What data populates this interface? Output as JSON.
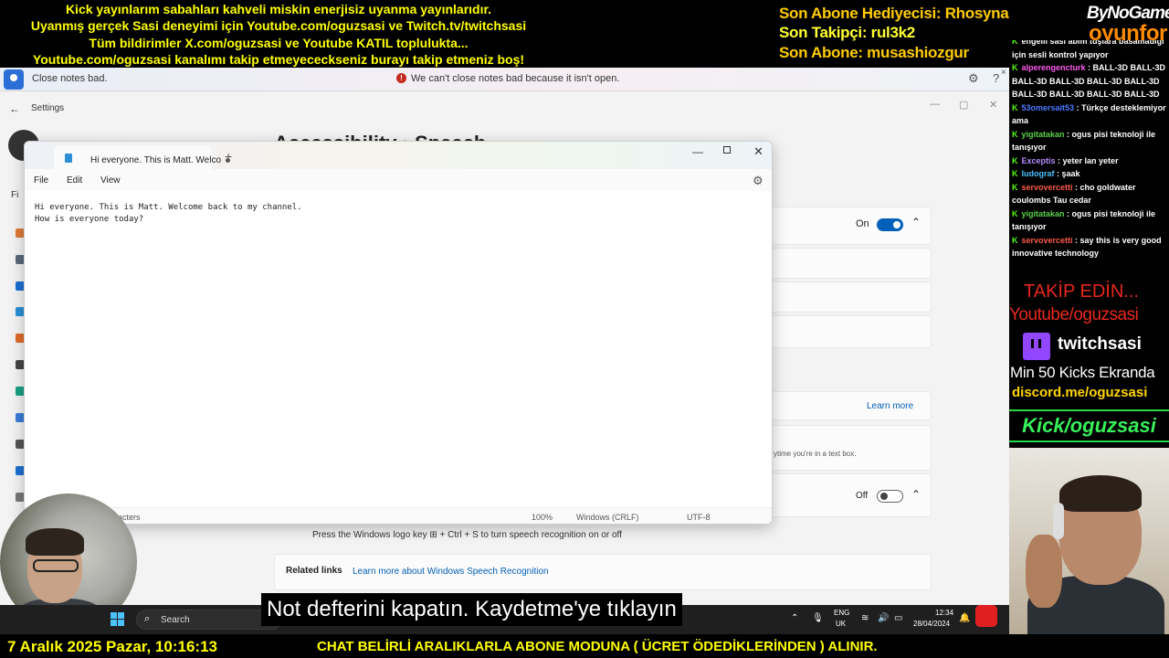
{
  "banner": {
    "lines": [
      "Kick yayınlarım sabahları kahveli miskin enerjisiz uyanma yayınlarıdır.",
      "Uyanmış gerçek Sasi deneyimi için Youtube.com/oguzsasi ve Twitch.tv/twitchsasi",
      "Tüm bildirimler X.com/oguzsasi ve Youtube KATIL toplulukta...",
      "Youtube.com/oguzsasi kanalımı takip etmeyececkseniz burayı takip etmeniz boş!"
    ],
    "sub_gift": "Son Abone Hediyecisi: Rhosyna",
    "last_follower": "Son Takipçi: rul3k2",
    "last_sub": "Son Abone: musashiozgur",
    "brand_top": "ByNoGame",
    "brand_bottom": "oyunfor"
  },
  "notification": {
    "left_text": "Close notes bad.",
    "message": "We can't close notes bad because it isn't open."
  },
  "settings": {
    "title": "Settings",
    "breadcrumb": "Accessibility  ›  Speech",
    "toggle_on_label": "On",
    "toggle_off_label": "Off",
    "learn_more": "Learn more",
    "textbox_hint": "ytime you're in a text box.",
    "shortcut_hint": "Press the Windows logo key ⊞ + Ctrl + S to turn speech recognition on or off",
    "related_links": "Related links",
    "related_link_1": "Learn more about Windows Speech Recognition"
  },
  "notepad": {
    "tab_title": "Hi everyone. This is Matt. Welcome",
    "menu": [
      "File",
      "Edit",
      "View"
    ],
    "content": "Hi everyone. This is Matt. Welcome back to my channel.\nHow is everyone today?",
    "status_chars": "aracters",
    "zoom": "100%",
    "line_ending": "Windows (CRLF)",
    "encoding": "UTF-8"
  },
  "taskbar": {
    "search_label": "Search",
    "lang_1": "ENG",
    "lang_2": "UK",
    "time": "12:34",
    "date": "28/04/2024"
  },
  "subtitle": "Not defterini kapatın.  Kaydetme'ye tıklayın",
  "bottom": {
    "datetime": "7 Aralık 2025 Pazar, 10:16:13",
    "message": "CHAT BELİRLİ ARALIKLARLA ABONE MODUNA ( ÜCRET ÖDEDİKLERİNDEN ) ALINIR."
  },
  "chat": [
    {
      "user": "",
      "user_color": "#4a7bff",
      "text": "engelli sasi abim tuşlara basamadığı için sesli kontrol yapıyor"
    },
    {
      "user": "alperengencturk",
      "user_color": "#ff5cf0",
      "text": "BALL-3D BALL-3D BALL-3D BALL-3D BALL-3D BALL-3D BALL-3D BALL-3D BALL-3D BALL-3D"
    },
    {
      "user": "53omersait53",
      "user_color": "#4a7bff",
      "text": "Türkçe desteklemiyor ama"
    },
    {
      "user": "yigitatakan",
      "user_color": "#5bd14a",
      "text": "ogus pisi teknoloji ile tanışıyor"
    },
    {
      "user": "Exceptis",
      "user_color": "#b58cff",
      "text": "yeter lan yeter"
    },
    {
      "user": "ludograf",
      "user_color": "#4ac2ff",
      "text": "şaak"
    },
    {
      "user": "servovercetti",
      "user_color": "#ff5a4a",
      "text": "cho goldwater coulombs Tau cedar"
    },
    {
      "user": "yigitatakan",
      "user_color": "#5bd14a",
      "text": "ogus pisi teknoloji ile tanışıyor"
    },
    {
      "user": "servovercetti",
      "user_color": "#ff5a4a",
      "text": "say this is very good innovative technology"
    }
  ],
  "promo": {
    "line1": "TAKİP EDİN...",
    "line2": "Youtube/oguzsasi",
    "twitch": "twitchsasi",
    "kicks": "Min 50 Kicks Ekranda",
    "discord": "discord.me/oguzsasi",
    "kick": "Kick/oguzsasi"
  }
}
